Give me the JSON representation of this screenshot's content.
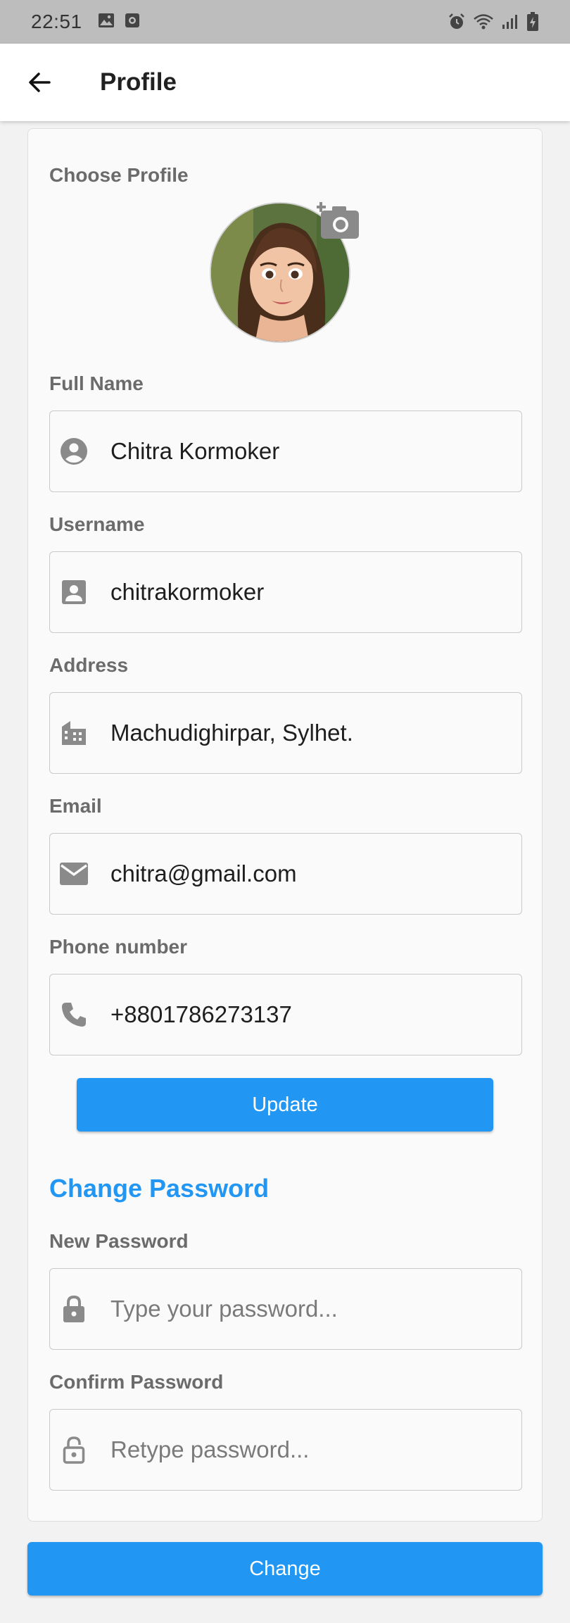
{
  "status_bar": {
    "time": "22:51",
    "icons": [
      "image-icon",
      "record-icon",
      "alarm-icon",
      "wifi-icon",
      "signal-icon",
      "battery-charging-icon"
    ]
  },
  "app_bar": {
    "title": "Profile",
    "back_icon": "arrow-left-icon"
  },
  "profile": {
    "choose_label": "Choose Profile",
    "camera_icon": "add-photo-camera-icon"
  },
  "fields": {
    "full_name": {
      "label": "Full Name",
      "value": "Chitra Kormoker",
      "icon": "account-circle-icon"
    },
    "username": {
      "label": "Username",
      "value": "chitrakormoker",
      "icon": "contact-badge-icon"
    },
    "address": {
      "label": "Address",
      "value": "Machudighirpar, Sylhet.",
      "icon": "building-icon"
    },
    "email": {
      "label": "Email",
      "value": "chitra@gmail.com",
      "icon": "mail-icon"
    },
    "phone": {
      "label": "Phone number",
      "value": "+8801786273137",
      "icon": "phone-icon"
    }
  },
  "update_button": "Update",
  "change_password": {
    "heading": "Change Password",
    "new_label": "New Password",
    "new_placeholder": "Type your password...",
    "confirm_label": "Confirm Password",
    "confirm_placeholder": "Retype password..."
  },
  "change_button": "Change",
  "colors": {
    "accent": "#2196f3",
    "label_gray": "#6b6b6b",
    "status_bar": "#bdbdbd",
    "icon_gray": "#8a8a8a"
  }
}
